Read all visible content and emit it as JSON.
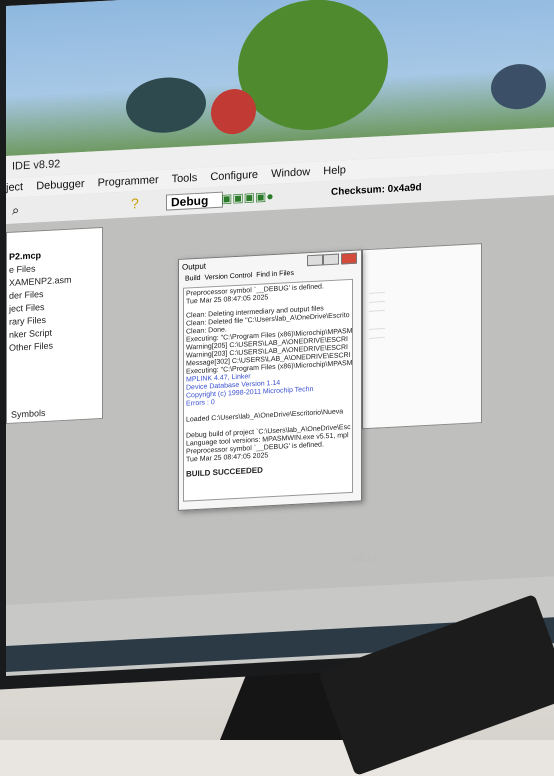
{
  "ide": {
    "title": "IDE v8.92",
    "menu": [
      "ject",
      "Debugger",
      "Programmer",
      "Tools",
      "Configure",
      "Window",
      "Help"
    ],
    "build_config": "Debug",
    "checksum": "Checksum: 0x4a9d"
  },
  "project": {
    "file": "P2.mcp",
    "items": [
      "e Files",
      "XAMENP2.asm",
      "der Files",
      "ject Files",
      "rary Files",
      "nker Script",
      "Other Files"
    ],
    "tab_symbols": "Symbols"
  },
  "output": {
    "title": "Output",
    "tabs": [
      "Build",
      "Version Control",
      "Find in Files"
    ],
    "lines": [
      "Preprocessor symbol `__DEBUG' is defined.",
      "Tue Mar 25 08:47:05 2025",
      "Clean: Deleting intermediary and output files",
      "Clean: Deleted file \"C:\\Users\\lab_A\\OneDrive\\Escrito",
      "Clean: Done.",
      "Executing: \"C:\\Program Files (x86)\\Microchip\\MPASM",
      "Warning[205] C:\\USERS\\LAB_A\\ONEDRIVE\\ESCRI",
      "Warning[203] C:\\USERS\\LAB_A\\ONEDRIVE\\ESCRI",
      "Message[302] C:\\USERS\\LAB_A\\ONEDRIVE\\ESCRI",
      "Executing: \"C:\\Program Files (x86)\\Microchip\\MPASM",
      "MPLINK 4.47, Linker",
      "Device Database Version 1.14",
      "Copyright (c) 1998-2011 Microchip Techn",
      "Errors    : 0",
      "Loaded C:\\Users\\lab_A\\OneDrive\\Escritorio\\Nueva",
      "Debug build of project `C:\\Users\\lab_A\\OneDrive\\Esc",
      "Language tool versions: MPASMWIN.exe v5.51, mpl",
      "Preprocessor symbol `__DEBUG' is defined.",
      "Tue Mar 25 08:47:05 2025",
      "BUILD SUCCEEDED"
    ]
  },
  "monitor": {
    "brand": "DELL"
  }
}
